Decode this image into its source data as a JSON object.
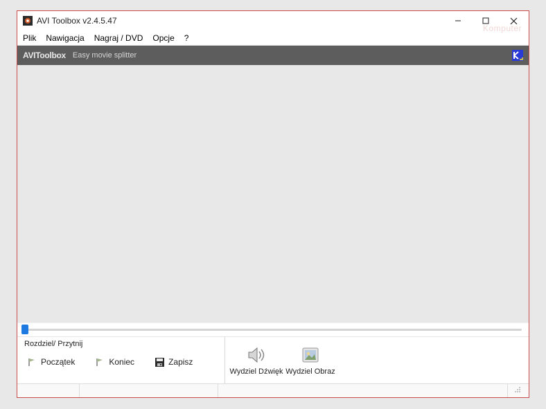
{
  "window": {
    "title": "AVI Toolbox v2.4.5.47"
  },
  "menu": {
    "items": [
      "Plik",
      "Nawigacja",
      "Nagraj / DVD",
      "Opcje",
      "?"
    ]
  },
  "brand": {
    "name": "AVIToolbox",
    "tagline": "Easy movie splitter",
    "watermark": "Komputer"
  },
  "slider": {
    "value": 0
  },
  "toolbar": {
    "group_title": "Rozdziel/ Przytnij",
    "begin_label": "Początek",
    "end_label": "Koniec",
    "save_label": "Zapisz",
    "extract_audio_label": "Wydziel Dźwięk",
    "extract_image_label": "Wydziel Obraz"
  },
  "status": {
    "cell1": "",
    "cell2": "",
    "cell3": "",
    "cell4": ""
  }
}
